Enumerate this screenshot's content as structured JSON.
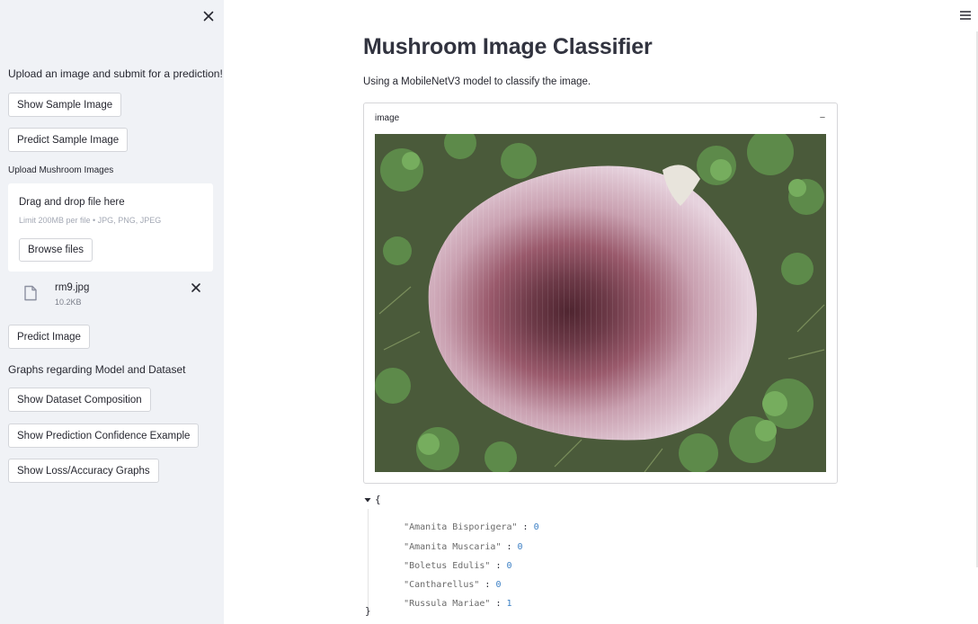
{
  "sidebar": {
    "intro_text": "Upload an image and submit for a prediction!",
    "show_sample_label": "Show Sample Image",
    "predict_sample_label": "Predict Sample Image",
    "upload_label": "Upload Mushroom Images",
    "dropzone": {
      "title": "Drag and drop file here",
      "limit": "Limit 200MB per file • JPG, PNG, JPEG",
      "browse_label": "Browse files"
    },
    "file": {
      "name": "rm9.jpg",
      "size": "10.2KB"
    },
    "predict_image_label": "Predict Image",
    "graphs_heading": "Graphs regarding Model and Dataset",
    "dataset_button_label": "Show Dataset Composition",
    "confidence_button_label": "Show Prediction Confidence Example",
    "loss_button_label": "Show Loss/Accuracy Graphs"
  },
  "main": {
    "title": "Mushroom Image Classifier",
    "subtitle": "Using a MobileNetV3 model to classify the image.",
    "image_label": "image",
    "collapse_symbol": "−"
  },
  "json_view": {
    "open_brace": "{",
    "close_brace": "}",
    "rows": [
      {
        "key": "\"Amanita Bisporigera\"",
        "value": "0"
      },
      {
        "key": "\"Amanita Muscaria\"",
        "value": "0"
      },
      {
        "key": "\"Boletus Edulis\"",
        "value": "0"
      },
      {
        "key": "\"Cantharellus\"",
        "value": "0"
      },
      {
        "key": "\"Russula Mariae\"",
        "value": "1"
      }
    ]
  },
  "icons": {
    "sidebar_close": "close-icon",
    "menu": "hamburger-menu-icon",
    "file": "file-icon",
    "file_delete": "close-icon",
    "json_toggle": "caret-down-icon"
  },
  "colors": {
    "sidebar_bg": "#f0f2f6",
    "json_value": "#3b7fc4",
    "json_key": "#6b6b6b"
  }
}
